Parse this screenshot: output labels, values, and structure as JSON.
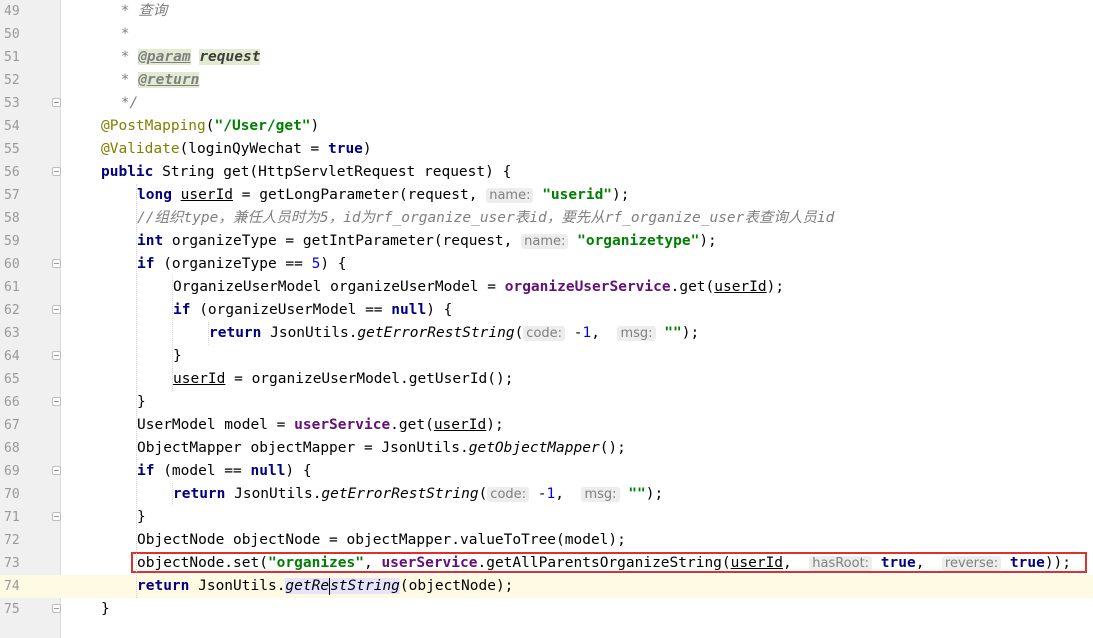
{
  "editor": {
    "current_line": 74,
    "lines": [
      {
        "num": "49",
        "tokens": [
          {
            "t": " * ",
            "c": "cmt"
          },
          {
            "t": "查询",
            "c": "cmt"
          }
        ]
      },
      {
        "num": "50",
        "tokens": [
          {
            "t": " *",
            "c": "cmt"
          }
        ]
      },
      {
        "num": "51",
        "tokens": [
          {
            "t": " * ",
            "c": "cmt"
          },
          {
            "t": "@param",
            "c": "doctag"
          },
          {
            "t": " ",
            "c": "cmt"
          },
          {
            "t": "request",
            "c": "docparam"
          }
        ]
      },
      {
        "num": "52",
        "tokens": [
          {
            "t": " * ",
            "c": "cmt"
          },
          {
            "t": "@return",
            "c": "doctag"
          }
        ]
      },
      {
        "num": "53",
        "tokens": [
          {
            "t": " */",
            "c": "cmt"
          }
        ]
      },
      {
        "num": "54",
        "tokens": [
          {
            "t": "@PostMapping",
            "c": "ann"
          },
          {
            "t": "(",
            "c": ""
          },
          {
            "t": "\"/User/get\"",
            "c": "str"
          },
          {
            "t": ")",
            "c": ""
          }
        ]
      },
      {
        "num": "55",
        "tokens": [
          {
            "t": "@Validate",
            "c": "ann"
          },
          {
            "t": "(loginQyWechat = ",
            "c": ""
          },
          {
            "t": "true",
            "c": "kw"
          },
          {
            "t": ")",
            "c": ""
          }
        ]
      },
      {
        "num": "56",
        "tokens": [
          {
            "t": "public",
            "c": "kw"
          },
          {
            "t": " String get(HttpServletRequest request) {",
            "c": ""
          }
        ]
      },
      {
        "num": "57",
        "tokens": [
          {
            "t": "long",
            "c": "kw"
          },
          {
            "t": " ",
            "c": ""
          },
          {
            "t": "userId",
            "c": "uvar"
          },
          {
            "t": " = getLongParameter(request, ",
            "c": ""
          },
          {
            "t": "name:",
            "c": "hint"
          },
          {
            "t": " ",
            "c": ""
          },
          {
            "t": "\"userid\"",
            "c": "str"
          },
          {
            "t": ");",
            "c": ""
          }
        ]
      },
      {
        "num": "58",
        "tokens": [
          {
            "t": "//组织type，兼任人员时为5，id为rf_organize_user表id，要先从rf_organize_user表查询人员id",
            "c": "cmt"
          }
        ]
      },
      {
        "num": "59",
        "tokens": [
          {
            "t": "int",
            "c": "kw"
          },
          {
            "t": " organizeType = getIntParameter(request, ",
            "c": ""
          },
          {
            "t": "name:",
            "c": "hint"
          },
          {
            "t": " ",
            "c": ""
          },
          {
            "t": "\"organizetype\"",
            "c": "str"
          },
          {
            "t": ");",
            "c": ""
          }
        ]
      },
      {
        "num": "60",
        "tokens": [
          {
            "t": "if",
            "c": "kw"
          },
          {
            "t": " (organizeType == ",
            "c": ""
          },
          {
            "t": "5",
            "c": "num"
          },
          {
            "t": ") {",
            "c": ""
          }
        ]
      },
      {
        "num": "61",
        "tokens": [
          {
            "t": "OrganizeUserModel organizeUserModel = ",
            "c": ""
          },
          {
            "t": "organizeUserService",
            "c": "field"
          },
          {
            "t": ".get(",
            "c": ""
          },
          {
            "t": "userId",
            "c": "uvar"
          },
          {
            "t": ");",
            "c": ""
          }
        ]
      },
      {
        "num": "62",
        "tokens": [
          {
            "t": "if",
            "c": "kw"
          },
          {
            "t": " (organizeUserModel == ",
            "c": ""
          },
          {
            "t": "null",
            "c": "kw"
          },
          {
            "t": ") {",
            "c": ""
          }
        ]
      },
      {
        "num": "63",
        "tokens": [
          {
            "t": "return",
            "c": "kw"
          },
          {
            "t": " JsonUtils.",
            "c": ""
          },
          {
            "t": "getErrorRestString",
            "c": "ital"
          },
          {
            "t": "(",
            "c": ""
          },
          {
            "t": "code:",
            "c": "hint"
          },
          {
            "t": " -",
            "c": ""
          },
          {
            "t": "1",
            "c": "num"
          },
          {
            "t": ",  ",
            "c": ""
          },
          {
            "t": "msg:",
            "c": "hint"
          },
          {
            "t": " ",
            "c": ""
          },
          {
            "t": "\"\"",
            "c": "str"
          },
          {
            "t": ");",
            "c": ""
          }
        ]
      },
      {
        "num": "64",
        "tokens": [
          {
            "t": "}",
            "c": ""
          }
        ]
      },
      {
        "num": "65",
        "tokens": [
          {
            "t": "userId",
            "c": "uvar"
          },
          {
            "t": " = organizeUserModel.getUserId();",
            "c": ""
          }
        ]
      },
      {
        "num": "66",
        "tokens": [
          {
            "t": "}",
            "c": ""
          }
        ]
      },
      {
        "num": "67",
        "tokens": [
          {
            "t": "UserModel model = ",
            "c": ""
          },
          {
            "t": "userService",
            "c": "field"
          },
          {
            "t": ".get(",
            "c": ""
          },
          {
            "t": "userId",
            "c": "uvar"
          },
          {
            "t": ");",
            "c": ""
          }
        ]
      },
      {
        "num": "68",
        "tokens": [
          {
            "t": "ObjectMapper objectMapper = JsonUtils.",
            "c": ""
          },
          {
            "t": "getObjectMapper",
            "c": "ital"
          },
          {
            "t": "();",
            "c": ""
          }
        ]
      },
      {
        "num": "69",
        "tokens": [
          {
            "t": "if",
            "c": "kw"
          },
          {
            "t": " (model == ",
            "c": ""
          },
          {
            "t": "null",
            "c": "kw"
          },
          {
            "t": ") {",
            "c": ""
          }
        ]
      },
      {
        "num": "70",
        "tokens": [
          {
            "t": "return",
            "c": "kw"
          },
          {
            "t": " JsonUtils.",
            "c": ""
          },
          {
            "t": "getErrorRestString",
            "c": "ital"
          },
          {
            "t": "(",
            "c": ""
          },
          {
            "t": "code:",
            "c": "hint"
          },
          {
            "t": " -",
            "c": ""
          },
          {
            "t": "1",
            "c": "num"
          },
          {
            "t": ",  ",
            "c": ""
          },
          {
            "t": "msg:",
            "c": "hint"
          },
          {
            "t": " ",
            "c": ""
          },
          {
            "t": "\"\"",
            "c": "str"
          },
          {
            "t": ");",
            "c": ""
          }
        ]
      },
      {
        "num": "71",
        "tokens": [
          {
            "t": "}",
            "c": ""
          }
        ]
      },
      {
        "num": "72",
        "tokens": [
          {
            "t": "ObjectNode objectNode = objectMapper.valueToTree(model);",
            "c": ""
          }
        ]
      },
      {
        "num": "73",
        "tokens": [
          {
            "t": "objectNode.set(",
            "c": ""
          },
          {
            "t": "\"organizes\"",
            "c": "str"
          },
          {
            "t": ", ",
            "c": ""
          },
          {
            "t": "userService",
            "c": "field"
          },
          {
            "t": ".getAllParentsOrganizeString(",
            "c": ""
          },
          {
            "t": "userId",
            "c": "uvar"
          },
          {
            "t": ",  ",
            "c": ""
          },
          {
            "t": "hasRoot:",
            "c": "hint"
          },
          {
            "t": " ",
            "c": ""
          },
          {
            "t": "true",
            "c": "kw"
          },
          {
            "t": ",  ",
            "c": ""
          },
          {
            "t": "reverse:",
            "c": "hint"
          },
          {
            "t": " ",
            "c": ""
          },
          {
            "t": "true",
            "c": "kw"
          },
          {
            "t": "));",
            "c": ""
          }
        ]
      },
      {
        "num": "74",
        "tokens": [
          {
            "t": "return",
            "c": "kw"
          },
          {
            "t": " JsonUtils.",
            "c": ""
          },
          {
            "t": "getRe",
            "c": "ital sel"
          },
          {
            "t": "",
            "c": "caret"
          },
          {
            "t": "stString",
            "c": "ital sel"
          },
          {
            "t": "(objectNode);",
            "c": ""
          }
        ]
      },
      {
        "num": "75",
        "tokens": [
          {
            "t": "}",
            "c": ""
          }
        ]
      }
    ]
  }
}
